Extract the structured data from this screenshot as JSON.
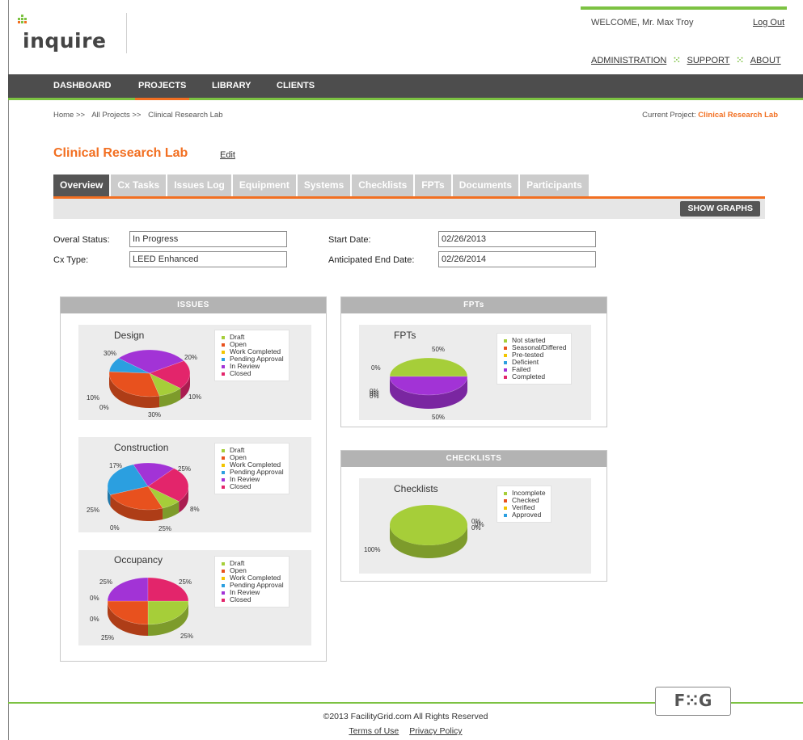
{
  "header": {
    "logo_text": "inquire",
    "welcome": "WELCOME, Mr. Max Troy",
    "logout": "Log Out",
    "links": [
      "ADMINISTRATION",
      "SUPPORT",
      "ABOUT"
    ]
  },
  "nav": {
    "items": [
      "DASHBOARD",
      "PROJECTS",
      "LIBRARY",
      "CLIENTS"
    ],
    "active_index": 1
  },
  "breadcrumb": {
    "items": [
      "Home >>",
      "All Projects >>",
      "Clinical Research Lab"
    ],
    "current_label": "Current Project:",
    "current_value": "Clinical Research Lab"
  },
  "project": {
    "title": "Clinical Research Lab",
    "edit": "Edit"
  },
  "tabs": {
    "items": [
      "Overview",
      "Cx Tasks",
      "Issues Log",
      "Equipment",
      "Systems",
      "Checklists",
      "FPTs",
      "Documents",
      "Participants"
    ],
    "active_index": 0,
    "show_graphs": "SHOW GRAPHS"
  },
  "form": {
    "overall_status_label": "Overal Status:",
    "overall_status_value": "In Progress",
    "cx_type_label": "Cx Type:",
    "cx_type_value": "LEED Enhanced",
    "start_date_label": "Start Date:",
    "start_date_value": "02/26/2013",
    "end_date_label": "Anticipated End Date:",
    "end_date_value": "02/26/2014"
  },
  "panels": {
    "issues": "ISSUES",
    "fpts": "FPTs",
    "checklists": "CHECKLISTS"
  },
  "colors": {
    "accent": "#f26f21",
    "green": "#7cc242",
    "nav": "#4d4d4d",
    "lime": "#a6ce39",
    "orange": "#e8511e",
    "yellow": "#f2c500",
    "blue": "#2b9fe0",
    "purple": "#a233d6",
    "pink": "#e3256b"
  },
  "chart_data": [
    {
      "type": "pie",
      "title": "Design",
      "legend": [
        "Draft",
        "Open",
        "Work Completed",
        "Pending Approval",
        "In Review",
        "Closed"
      ],
      "values": [
        10,
        30,
        0,
        10,
        30,
        20
      ],
      "labels": [
        "10%",
        "30%",
        "0%",
        "10%",
        "30%",
        "20%"
      ]
    },
    {
      "type": "pie",
      "title": "Construction",
      "legend": [
        "Draft",
        "Open",
        "Work Completed",
        "Pending Approval",
        "In Review",
        "Closed"
      ],
      "values": [
        8,
        25,
        0,
        25,
        17,
        25
      ],
      "labels": [
        "8%",
        "25%",
        "0%",
        "25%",
        "17%",
        "25%"
      ]
    },
    {
      "type": "pie",
      "title": "Occupancy",
      "legend": [
        "Draft",
        "Open",
        "Work Completed",
        "Pending Approval",
        "In Review",
        "Closed"
      ],
      "values": [
        25,
        25,
        0,
        0,
        25,
        25
      ],
      "labels": [
        "25%",
        "25%",
        "0%",
        "0%",
        "25%",
        "25%"
      ]
    },
    {
      "type": "pie",
      "title": "FPTs",
      "legend": [
        "Not started",
        "Seasonal/Differed",
        "Pre-tested",
        "Deficient",
        "Failed",
        "Completed"
      ],
      "values": [
        50,
        0,
        0,
        0,
        50,
        0
      ],
      "labels": [
        "50%",
        "0%",
        "0%",
        "0%",
        "50%",
        "0%"
      ]
    },
    {
      "type": "pie",
      "title": "Checklists",
      "legend": [
        "Incomplete",
        "Checked",
        "Verified",
        "Approved"
      ],
      "values": [
        100,
        0,
        0,
        0
      ],
      "labels": [
        "100%",
        "0%",
        "0%",
        "0%"
      ]
    }
  ],
  "footer": {
    "logo": "F⁙G",
    "copyright": "©2013 FacilityGrid.com  All Rights Reserved",
    "terms": "Terms of Use",
    "privacy": "Privacy Policy"
  }
}
